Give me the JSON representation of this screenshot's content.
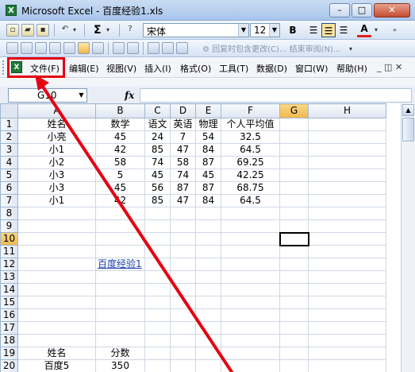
{
  "window": {
    "title": "Microsoft Excel - 百度经验1.xls",
    "app_icon": "X",
    "buttons": {
      "minimize": "–",
      "maximize": "□",
      "close": "✕"
    }
  },
  "toolbar": {
    "font_name": "宋体",
    "font_size": "12",
    "bold": "B",
    "font_color": "A",
    "review_text": "⚙ 回复时包含更改(C)... 结束审阅(N)...",
    "sigma": "Σ"
  },
  "menu": {
    "items": [
      "文件(F)",
      "编辑(E)",
      "视图(V)",
      "插入(I)",
      "格式(O)",
      "工具(T)",
      "数据(D)",
      "窗口(W)",
      "帮助(H)"
    ],
    "controls": "_ ◫ ✕"
  },
  "formula_bar": {
    "name_box": "G10",
    "fx": "fx",
    "value": ""
  },
  "sheet": {
    "columns": [
      "A",
      "B",
      "C",
      "D",
      "E",
      "F",
      "G",
      "H"
    ],
    "active_column": "G",
    "active_row": "10",
    "rows": [
      {
        "n": "1",
        "cells": [
          "姓名",
          "数学",
          "语文",
          "英语",
          "物理",
          "个人平均值",
          "",
          ""
        ]
      },
      {
        "n": "2",
        "cells": [
          "小亮",
          "45",
          "24",
          "7",
          "54",
          "32.5",
          "",
          ""
        ]
      },
      {
        "n": "3",
        "cells": [
          "小1",
          "42",
          "85",
          "47",
          "84",
          "64.5",
          "",
          ""
        ]
      },
      {
        "n": "4",
        "cells": [
          "小2",
          "58",
          "74",
          "58",
          "87",
          "69.25",
          "",
          ""
        ]
      },
      {
        "n": "5",
        "cells": [
          "小3",
          "5",
          "45",
          "74",
          "45",
          "42.25",
          "",
          ""
        ]
      },
      {
        "n": "6",
        "cells": [
          "小3",
          "45",
          "56",
          "87",
          "87",
          "68.75",
          "",
          ""
        ]
      },
      {
        "n": "7",
        "cells": [
          "小1",
          "42",
          "85",
          "47",
          "84",
          "64.5",
          "",
          ""
        ]
      },
      {
        "n": "8",
        "cells": [
          "",
          "",
          "",
          "",
          "",
          "",
          "",
          ""
        ]
      },
      {
        "n": "9",
        "cells": [
          "",
          "",
          "",
          "",
          "",
          "",
          "",
          ""
        ]
      },
      {
        "n": "10",
        "cells": [
          "",
          "",
          "",
          "",
          "",
          "",
          "",
          ""
        ]
      },
      {
        "n": "11",
        "cells": [
          "",
          "",
          "",
          "",
          "",
          "",
          "",
          ""
        ]
      },
      {
        "n": "12",
        "cells": [
          "",
          "百度经验1",
          "",
          "",
          "",
          "",
          "",
          ""
        ]
      },
      {
        "n": "13",
        "cells": [
          "",
          "",
          "",
          "",
          "",
          "",
          "",
          ""
        ]
      },
      {
        "n": "14",
        "cells": [
          "",
          "",
          "",
          "",
          "",
          "",
          "",
          ""
        ]
      },
      {
        "n": "15",
        "cells": [
          "",
          "",
          "",
          "",
          "",
          "",
          "",
          ""
        ]
      },
      {
        "n": "16",
        "cells": [
          "",
          "",
          "",
          "",
          "",
          "",
          "",
          ""
        ]
      },
      {
        "n": "17",
        "cells": [
          "",
          "",
          "",
          "",
          "",
          "",
          "",
          ""
        ]
      },
      {
        "n": "18",
        "cells": [
          "",
          "",
          "",
          "",
          "",
          "",
          "",
          ""
        ]
      },
      {
        "n": "19",
        "cells": [
          "姓名",
          "分数",
          "",
          "",
          "",
          "",
          "",
          ""
        ]
      },
      {
        "n": "20",
        "cells": [
          "百度5",
          "350",
          "",
          "",
          "",
          "",
          "",
          ""
        ]
      }
    ]
  },
  "colors": {
    "highlight": "#e60012",
    "link": "#1f3fb0",
    "active_header": "#f2b74a"
  }
}
